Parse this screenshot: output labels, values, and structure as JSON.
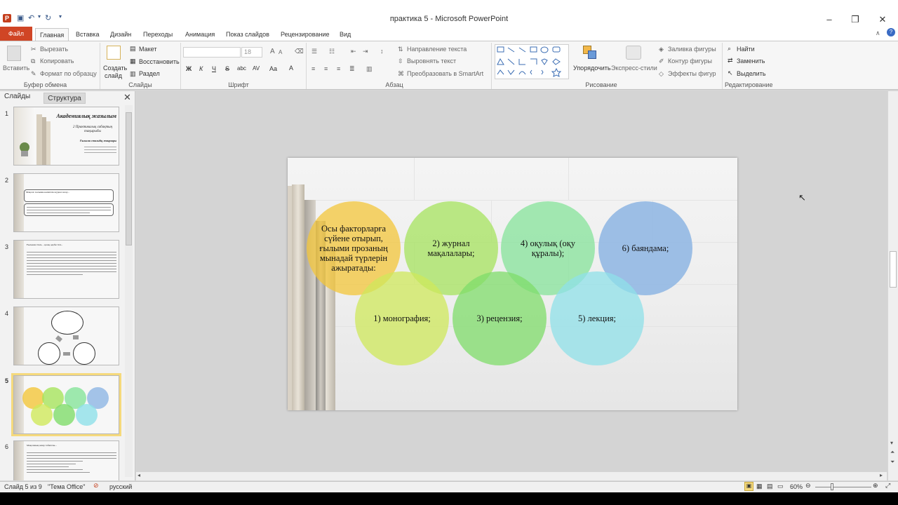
{
  "window": {
    "title": "практика 5 - Microsoft PowerPoint",
    "app_icon_letter": "P"
  },
  "tabs": [
    "Файл",
    "Главная",
    "Вставка",
    "Дизайн",
    "Переходы",
    "Анимация",
    "Показ слайдов",
    "Рецензирование",
    "Вид"
  ],
  "ribbon": {
    "clipboard": {
      "paste": "Вставить",
      "cut": "Вырезать",
      "copy": "Копировать",
      "format_painter": "Формат по образцу",
      "group": "Буфер обмена"
    },
    "slides": {
      "new_slide_1": "Создать",
      "new_slide_2": "слайд",
      "layout": "Макет",
      "reset": "Восстановить",
      "section": "Раздел",
      "group": "Слайды"
    },
    "font": {
      "size": "18",
      "bold": "Ж",
      "italic": "К",
      "underline": "Ч",
      "strike": "S",
      "shadow": "abc",
      "spacing": "AV",
      "case": "Aa",
      "color": "A",
      "grow": "A",
      "group": "Шрифт"
    },
    "paragraph": {
      "text_direction": "Направление текста",
      "align_text": "Выровнять текст",
      "smartart": "Преобразовать в SmartArt",
      "group": "Абзац"
    },
    "drawing": {
      "arrange": "Упорядочить",
      "quick_styles": "Экспресс-стили",
      "shape_fill": "Заливка фигуры",
      "shape_outline": "Контур фигуры",
      "shape_effects": "Эффекты фигур",
      "group": "Рисование"
    },
    "editing": {
      "find": "Найти",
      "replace": "Заменить",
      "select": "Выделить",
      "group": "Редактирование"
    }
  },
  "left_pane": {
    "tab_slides": "Слайды",
    "tab_outline": "Структура",
    "close": "✕"
  },
  "thumbnails": [
    {
      "num": "1",
      "title": "Академиялық жазылым",
      "sub": "2 Практикалық сабақтың тақырыбы",
      "sub2": "Ғылыми стильдің жанрлары"
    },
    {
      "num": "2",
      "line1": "Мақала: ғылыми-көпшілік журнал жазу..."
    },
    {
      "num": "3",
      "line1": "Ғылыми стиль – қазақ әдеби тілі..."
    },
    {
      "num": "4"
    },
    {
      "num": "5"
    },
    {
      "num": "6",
      "line1": "Мақаланың жанр табиғаты..."
    }
  ],
  "slide": {
    "circles": [
      {
        "label": "Осы факторларға сүйене отырып, ғылыми прозаның мынадай түрлерін ажыратады:",
        "color": "#f3c53a"
      },
      {
        "label": "2) журнал мақалалары;",
        "color": "#a6e35d"
      },
      {
        "label": "4) оқулық (оқу құралы);",
        "color": "#86e39a"
      },
      {
        "label": "6) баяндама;",
        "color": "#8db5e3"
      },
      {
        "label": "1) монография;",
        "color": "#cfe85b"
      },
      {
        "label": "3) рецензия;",
        "color": "#7fdc6a"
      },
      {
        "label": "5) лекция;",
        "color": "#8fe0e8"
      }
    ]
  },
  "status": {
    "slide_of": "Слайд 5 из 9",
    "theme": "\"Тема Office\"",
    "language": "русский",
    "zoom": "60%"
  }
}
